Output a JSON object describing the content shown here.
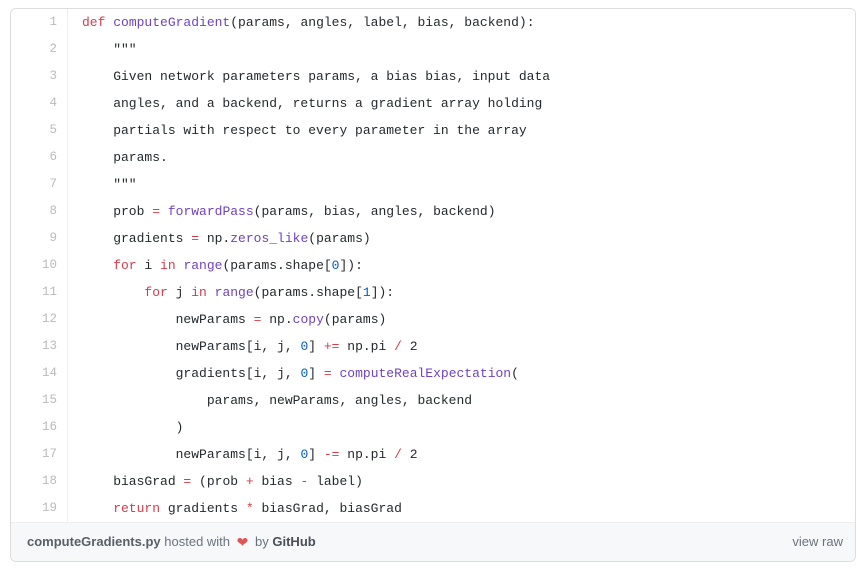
{
  "gist": {
    "filename": "computeGradients.py",
    "language": "python",
    "footer": {
      "hosted_with_prefix": "hosted with",
      "heart_icon": "heart-icon",
      "by_label": "by",
      "host_name": "GitHub",
      "view_raw_label": "view raw"
    },
    "colors": {
      "keyword": "#d73a49",
      "function": "#6f42c1",
      "number": "#005cc5",
      "text": "#24292e",
      "line_number": "#babbbc",
      "border": "#dddddd",
      "footer_bg": "#f6f8fa",
      "heart": "#e25555"
    },
    "lines": [
      {
        "number": "1",
        "tokens": [
          {
            "t": "def ",
            "c": "k"
          },
          {
            "t": "computeGradient",
            "c": "fn"
          },
          {
            "t": "(params, angles, label, bias, backend):",
            "c": "p"
          }
        ]
      },
      {
        "number": "2",
        "tokens": [
          {
            "t": "    \"\"\"",
            "c": "p"
          }
        ]
      },
      {
        "number": "3",
        "tokens": [
          {
            "t": "    Given network parameters params, a bias bias, input data",
            "c": "p"
          }
        ]
      },
      {
        "number": "4",
        "tokens": [
          {
            "t": "    angles, and a backend, returns a gradient array holding",
            "c": "p"
          }
        ]
      },
      {
        "number": "5",
        "tokens": [
          {
            "t": "    partials with respect to every parameter in the array",
            "c": "p"
          }
        ]
      },
      {
        "number": "6",
        "tokens": [
          {
            "t": "    params.",
            "c": "p"
          }
        ]
      },
      {
        "number": "7",
        "tokens": [
          {
            "t": "    \"\"\"",
            "c": "p"
          }
        ]
      },
      {
        "number": "8",
        "tokens": [
          {
            "t": "    prob ",
            "c": "p"
          },
          {
            "t": "=",
            "c": "k"
          },
          {
            "t": " ",
            "c": "p"
          },
          {
            "t": "forwardPass",
            "c": "fn"
          },
          {
            "t": "(params, bias, angles, backend)",
            "c": "p"
          }
        ]
      },
      {
        "number": "9",
        "tokens": [
          {
            "t": "    gradients ",
            "c": "p"
          },
          {
            "t": "=",
            "c": "k"
          },
          {
            "t": " np.",
            "c": "p"
          },
          {
            "t": "zeros_like",
            "c": "fn"
          },
          {
            "t": "(params)",
            "c": "p"
          }
        ]
      },
      {
        "number": "10",
        "tokens": [
          {
            "t": "    for",
            "c": "k"
          },
          {
            "t": " i ",
            "c": "p"
          },
          {
            "t": "in",
            "c": "k"
          },
          {
            "t": " ",
            "c": "p"
          },
          {
            "t": "range",
            "c": "fn"
          },
          {
            "t": "(params.shape[",
            "c": "p"
          },
          {
            "t": "0",
            "c": "n"
          },
          {
            "t": "]):",
            "c": "p"
          }
        ]
      },
      {
        "number": "11",
        "tokens": [
          {
            "t": "        for",
            "c": "k"
          },
          {
            "t": " j ",
            "c": "p"
          },
          {
            "t": "in",
            "c": "k"
          },
          {
            "t": " ",
            "c": "p"
          },
          {
            "t": "range",
            "c": "fn"
          },
          {
            "t": "(params.shape[",
            "c": "p"
          },
          {
            "t": "1",
            "c": "n"
          },
          {
            "t": "]):",
            "c": "p"
          }
        ]
      },
      {
        "number": "12",
        "tokens": [
          {
            "t": "            newParams ",
            "c": "p"
          },
          {
            "t": "=",
            "c": "k"
          },
          {
            "t": " np.",
            "c": "p"
          },
          {
            "t": "copy",
            "c": "fn"
          },
          {
            "t": "(params)",
            "c": "p"
          }
        ]
      },
      {
        "number": "13",
        "tokens": [
          {
            "t": "            newParams[i, j, ",
            "c": "p"
          },
          {
            "t": "0",
            "c": "n"
          },
          {
            "t": "] ",
            "c": "p"
          },
          {
            "t": "+=",
            "c": "k"
          },
          {
            "t": " np.pi ",
            "c": "p"
          },
          {
            "t": "/",
            "c": "k"
          },
          {
            "t": " 2",
            "c": "p"
          }
        ]
      },
      {
        "number": "14",
        "tokens": [
          {
            "t": "            gradients[i, j, ",
            "c": "p"
          },
          {
            "t": "0",
            "c": "n"
          },
          {
            "t": "] ",
            "c": "p"
          },
          {
            "t": "=",
            "c": "k"
          },
          {
            "t": " ",
            "c": "p"
          },
          {
            "t": "computeRealExpectation",
            "c": "fn"
          },
          {
            "t": "(",
            "c": "p"
          }
        ]
      },
      {
        "number": "15",
        "tokens": [
          {
            "t": "                params, newParams, angles, backend",
            "c": "p"
          }
        ]
      },
      {
        "number": "16",
        "tokens": [
          {
            "t": "            )",
            "c": "p"
          }
        ]
      },
      {
        "number": "17",
        "tokens": [
          {
            "t": "            newParams[i, j, ",
            "c": "p"
          },
          {
            "t": "0",
            "c": "n"
          },
          {
            "t": "] ",
            "c": "p"
          },
          {
            "t": "-=",
            "c": "k"
          },
          {
            "t": " np.pi ",
            "c": "p"
          },
          {
            "t": "/",
            "c": "k"
          },
          {
            "t": " 2",
            "c": "p"
          }
        ]
      },
      {
        "number": "18",
        "tokens": [
          {
            "t": "    biasGrad ",
            "c": "p"
          },
          {
            "t": "=",
            "c": "k"
          },
          {
            "t": " (prob ",
            "c": "p"
          },
          {
            "t": "+",
            "c": "k"
          },
          {
            "t": " bias ",
            "c": "p"
          },
          {
            "t": "-",
            "c": "k"
          },
          {
            "t": " label)",
            "c": "p"
          }
        ]
      },
      {
        "number": "19",
        "tokens": [
          {
            "t": "    return",
            "c": "k"
          },
          {
            "t": " gradients ",
            "c": "p"
          },
          {
            "t": "*",
            "c": "k"
          },
          {
            "t": " biasGrad, biasGrad",
            "c": "p"
          }
        ]
      }
    ]
  }
}
